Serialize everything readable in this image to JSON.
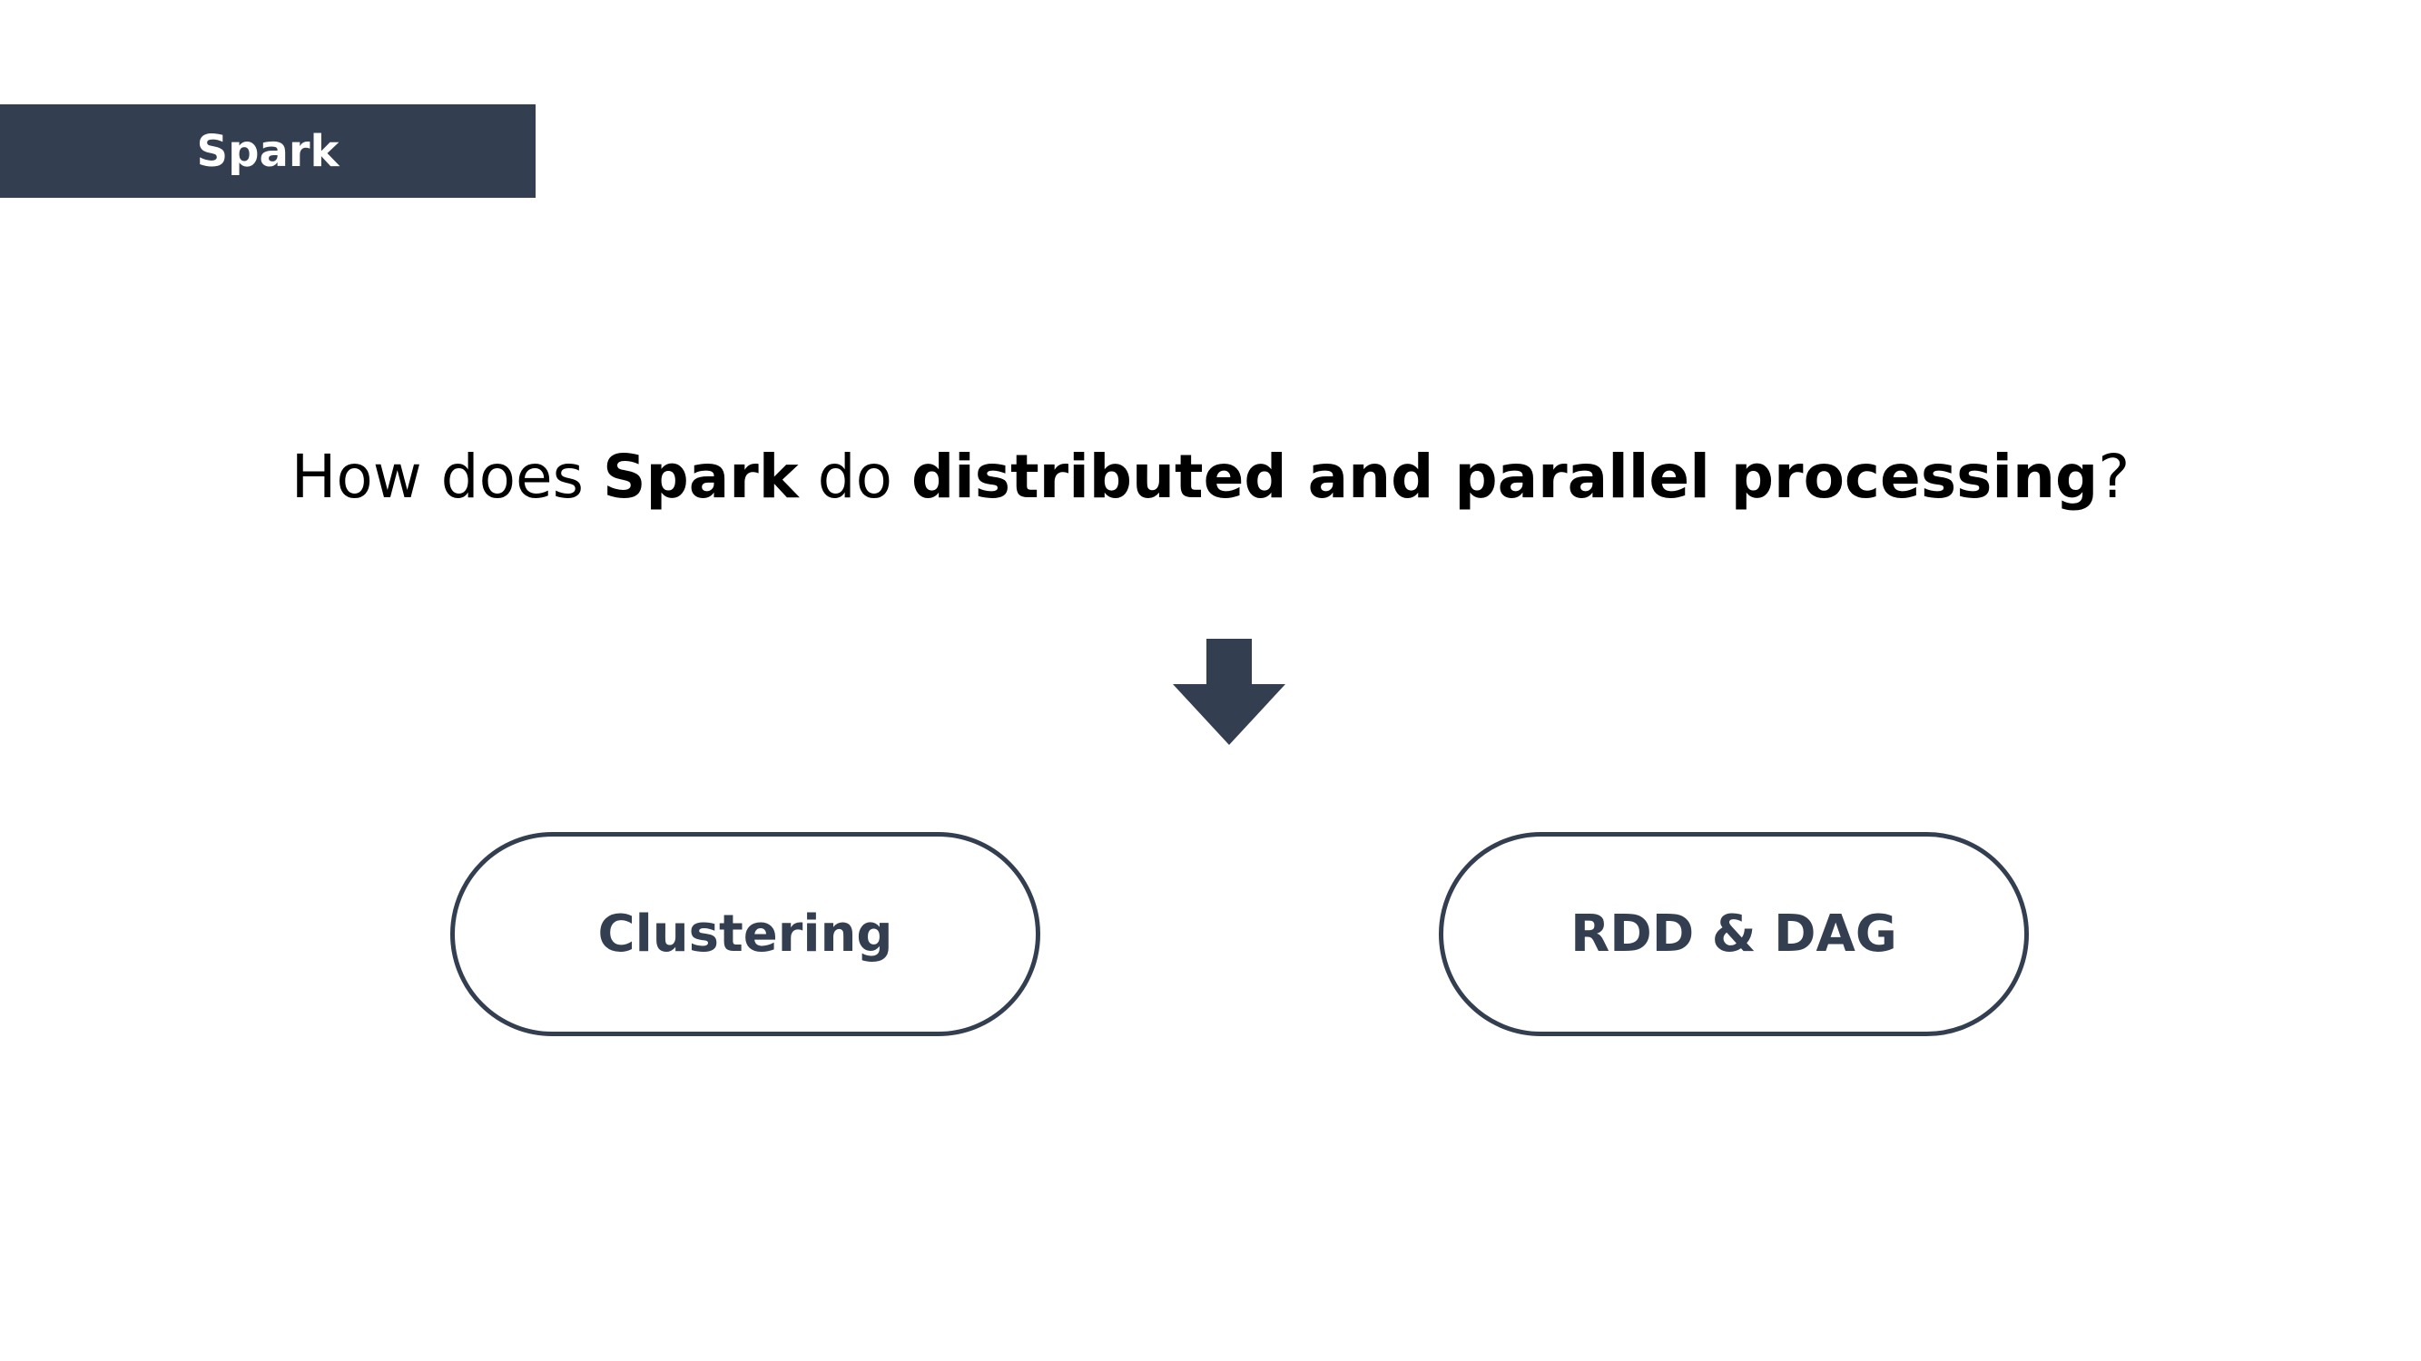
{
  "header": {
    "section_label": "Spark"
  },
  "question": {
    "part1": "How does ",
    "part2": "Spark",
    "part3": " do ",
    "part4": "distributed and parallel processing",
    "part5": "?"
  },
  "arrow": {
    "icon": "down-arrow-icon",
    "color": "#333f50"
  },
  "concepts": [
    {
      "label": "Clustering"
    },
    {
      "label": "RDD & DAG"
    }
  ],
  "colors": {
    "accent": "#333f50",
    "background": "#ffffff",
    "text": "#000000"
  }
}
